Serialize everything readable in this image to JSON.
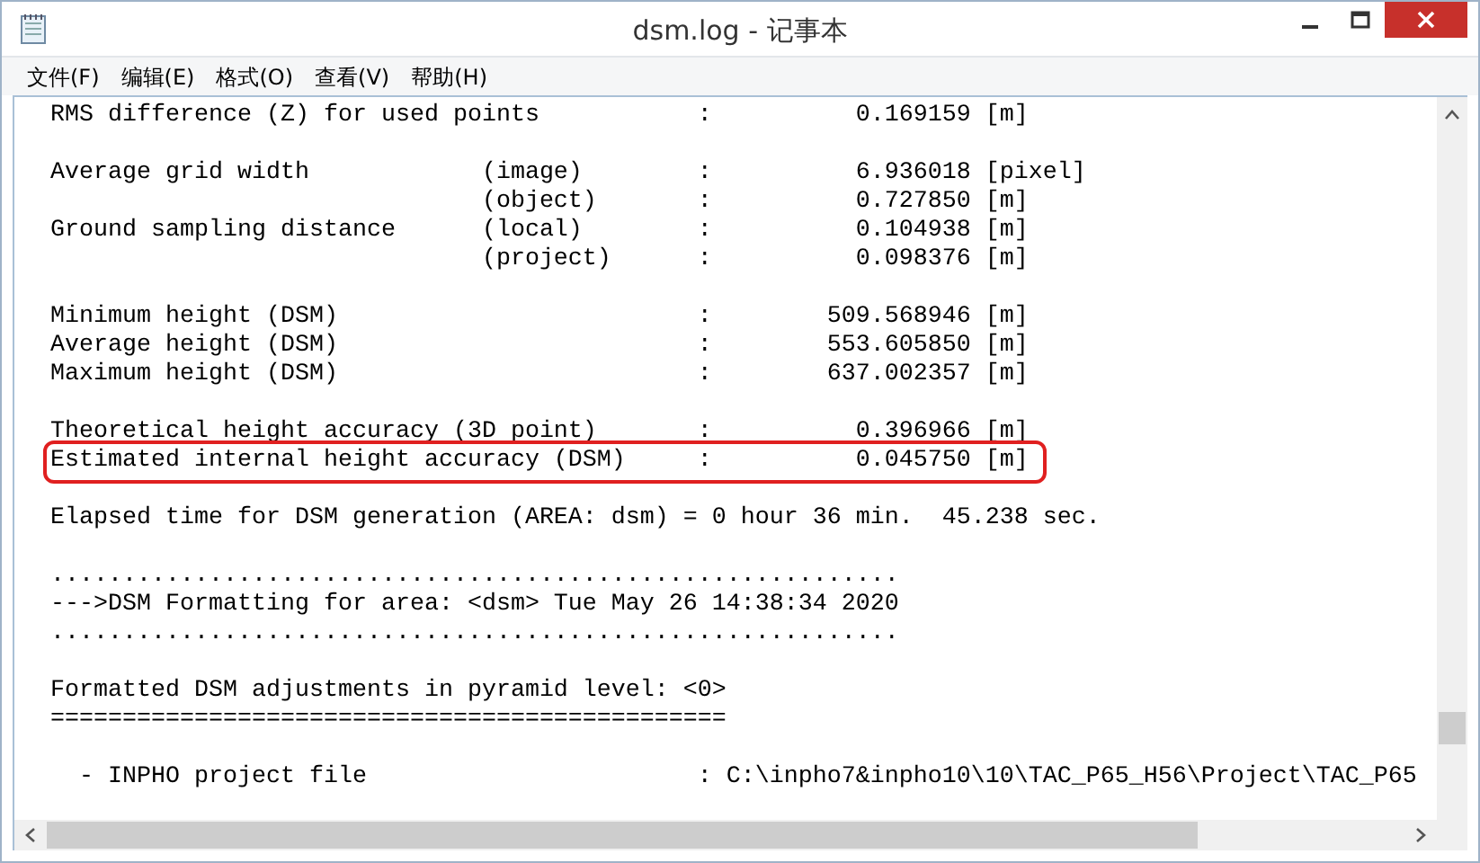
{
  "window": {
    "title": "dsm.log - 记事本"
  },
  "menu": [
    "文件(F)",
    "编辑(E)",
    "格式(O)",
    "查看(V)",
    "帮助(H)"
  ],
  "blocks": [
    {
      "lines": [
        {
          "text": "RMS difference (Z) for used points           :          0.169159 [m]",
          "highlighted": false
        }
      ]
    },
    {
      "lines": [
        {
          "text": "Average grid width            (image)        :          6.936018 [pixel]",
          "highlighted": false
        },
        {
          "text": "                              (object)       :          0.727850 [m]",
          "highlighted": false
        },
        {
          "text": "Ground sampling distance      (local)        :          0.104938 [m]",
          "highlighted": false
        },
        {
          "text": "                              (project)      :          0.098376 [m]",
          "highlighted": false
        }
      ]
    },
    {
      "lines": [
        {
          "text": "Minimum height (DSM)                         :        509.568946 [m]",
          "highlighted": false
        },
        {
          "text": "Average height (DSM)                         :        553.605850 [m]",
          "highlighted": false
        },
        {
          "text": "Maximum height (DSM)                         :        637.002357 [m]",
          "highlighted": false
        }
      ]
    },
    {
      "lines": [
        {
          "text": "Theoretical height accuracy (3D point)       :          0.396966 [m]",
          "highlighted": false
        },
        {
          "text": "Estimated internal height accuracy (DSM)     :          0.045750 [m]",
          "highlighted": true
        }
      ]
    },
    {
      "lines": [
        {
          "text": "Elapsed time for DSM generation (AREA: dsm) = 0 hour 36 min.  45.238 sec.",
          "highlighted": false
        }
      ]
    },
    {
      "lines": [
        {
          "text": "...........................................................",
          "highlighted": false
        },
        {
          "text": "--->DSM Formatting for area: <dsm> Tue May 26 14:38:34 2020",
          "highlighted": false
        },
        {
          "text": "...........................................................",
          "highlighted": false
        }
      ]
    },
    {
      "lines": [
        {
          "text": "Formatted DSM adjustments in pyramid level: <0>",
          "highlighted": false
        },
        {
          "text": "===============================================",
          "highlighted": false
        }
      ]
    },
    {
      "lines": [
        {
          "text": "  - INPHO project file                       : C:\\inpho7&inpho10\\10\\TAC_P65_H56\\Project\\TAC_P65",
          "highlighted": false
        }
      ]
    }
  ]
}
